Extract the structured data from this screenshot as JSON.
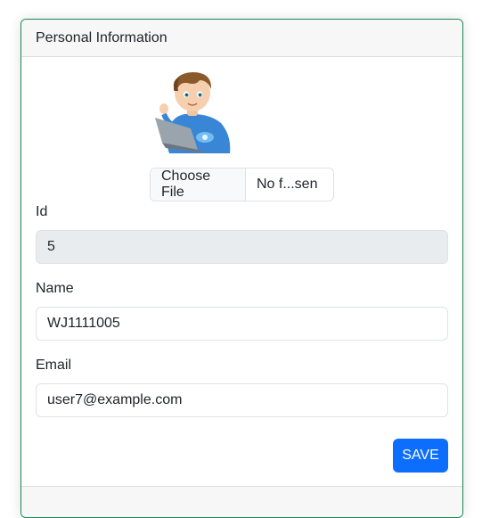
{
  "card": {
    "title": "Personal Information"
  },
  "avatar": {
    "icon": "boy-with-laptop-avatar"
  },
  "file_input": {
    "button_label": "Choose File",
    "file_name": "No f...sen"
  },
  "fields": {
    "id": {
      "label": "Id",
      "value": "5"
    },
    "name": {
      "label": "Name",
      "value": "WJ1111005"
    },
    "email": {
      "label": "Email",
      "value": "user7@example.com"
    }
  },
  "actions": {
    "save_label": "SAVE"
  },
  "colors": {
    "primary": "#0d6efd",
    "card_border": "#198754",
    "disabled_input_bg": "#e9ecef"
  }
}
